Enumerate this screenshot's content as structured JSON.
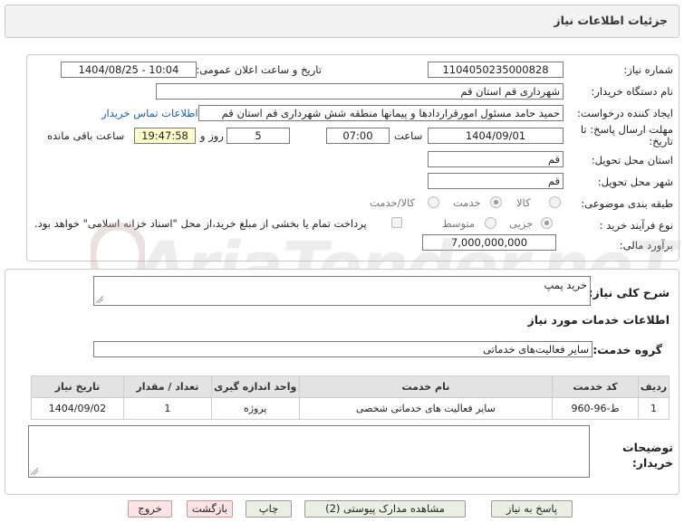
{
  "header": {
    "title": "جزئیات اطلاعات نیاز"
  },
  "watermark": "AriaTender.neT",
  "form": {
    "need_number_label": "شماره نیاز:",
    "need_number": "1104050235000828",
    "announce_label": "تاریخ و ساعت اعلان عمومی:",
    "announce_value": "1404/08/25 - 10:04",
    "buyer_org_label": "نام دستگاه خریدار:",
    "buyer_org": "شهرداری قم استان قم",
    "creator_label": "ایجاد کننده درخواست:",
    "creator": "حمید حامد مسئول امورقراردادها و پیمانها منطقه شش شهرداری قم استان قم",
    "contact_link": "اطلاعات تماس خریدار",
    "deadline_label": "مهلت ارسال پاسخ: تا تاریخ:",
    "deadline_date": "1404/09/01",
    "time_label": "ساعت",
    "deadline_time": "07:00",
    "days_value": "5",
    "days_label": "روز و",
    "remaining_time": "19:47:58",
    "remaining_label": "ساعت باقی مانده",
    "province_label": "استان محل تحویل:",
    "province": "قم",
    "city_label": "شهر محل تحویل:",
    "city": "قم",
    "category_label": "طبقه بندی موضوعی:",
    "category_options": {
      "goods": "کالا",
      "service": "خدمت",
      "goods_service": "کالا/خدمت"
    },
    "purchase_type_label": "نوع فرآیند خرید :",
    "purchase_options": {
      "partial": "جزیی",
      "medium": "متوسط"
    },
    "payment_note": "پرداخت تمام یا بخشی از مبلغ خرید،از محل \"اسناد خزانه اسلامی\" خواهد بود.",
    "estimate_label": "برآورد مالی:",
    "estimate": "7,000,000,000"
  },
  "summary": {
    "label": "شرح کلی نیاز:",
    "value": "خرید پمپ"
  },
  "services": {
    "section_title": "اطلاعات خدمات مورد نیاز",
    "group_label": "گروه خدمت:",
    "group_value": "سایر فعالیت‌های خدماتی",
    "table_headers": [
      "ردیف",
      "کد خدمت",
      "نام خدمت",
      "واحد اندازه گیری",
      "تعداد / مقدار",
      "تاریخ نیاز"
    ],
    "rows": [
      [
        "1",
        "ط-96-960",
        "سایر فعالیت های خدماتی شخصی",
        "پروژه",
        "1",
        "1404/09/02"
      ]
    ]
  },
  "buyer_notes_label": "توضیحات خریدار:",
  "buttons": {
    "reply": "پاسخ به نیاز",
    "attachments": "مشاهده مدارک پیوستی (2)",
    "print": "چاپ",
    "back": "بازگشت",
    "exit": "خروج"
  }
}
